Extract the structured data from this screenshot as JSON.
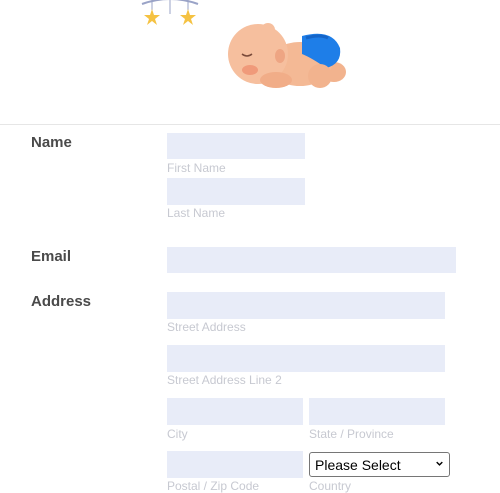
{
  "form": {
    "name": {
      "label": "Name",
      "first_name_sublabel": "First Name",
      "last_name_sublabel": "Last Name"
    },
    "email": {
      "label": "Email"
    },
    "address": {
      "label": "Address",
      "street_sublabel": "Street Address",
      "street2_sublabel": "Street Address Line 2",
      "city_sublabel": "City",
      "state_sublabel": "State / Province",
      "postal_sublabel": "Postal / Zip Code",
      "country_sublabel": "Country",
      "country_select_value": "Please Select"
    }
  },
  "colors": {
    "field_background": "#e8ecf8",
    "label_text": "#4a4a4a",
    "sublabel_text": "#c7c9d1",
    "diaper_blue": "#1e7ee8"
  },
  "icons": [
    "baby-mobile-icon",
    "sleeping-baby-illustration",
    "chevron-down-icon"
  ]
}
